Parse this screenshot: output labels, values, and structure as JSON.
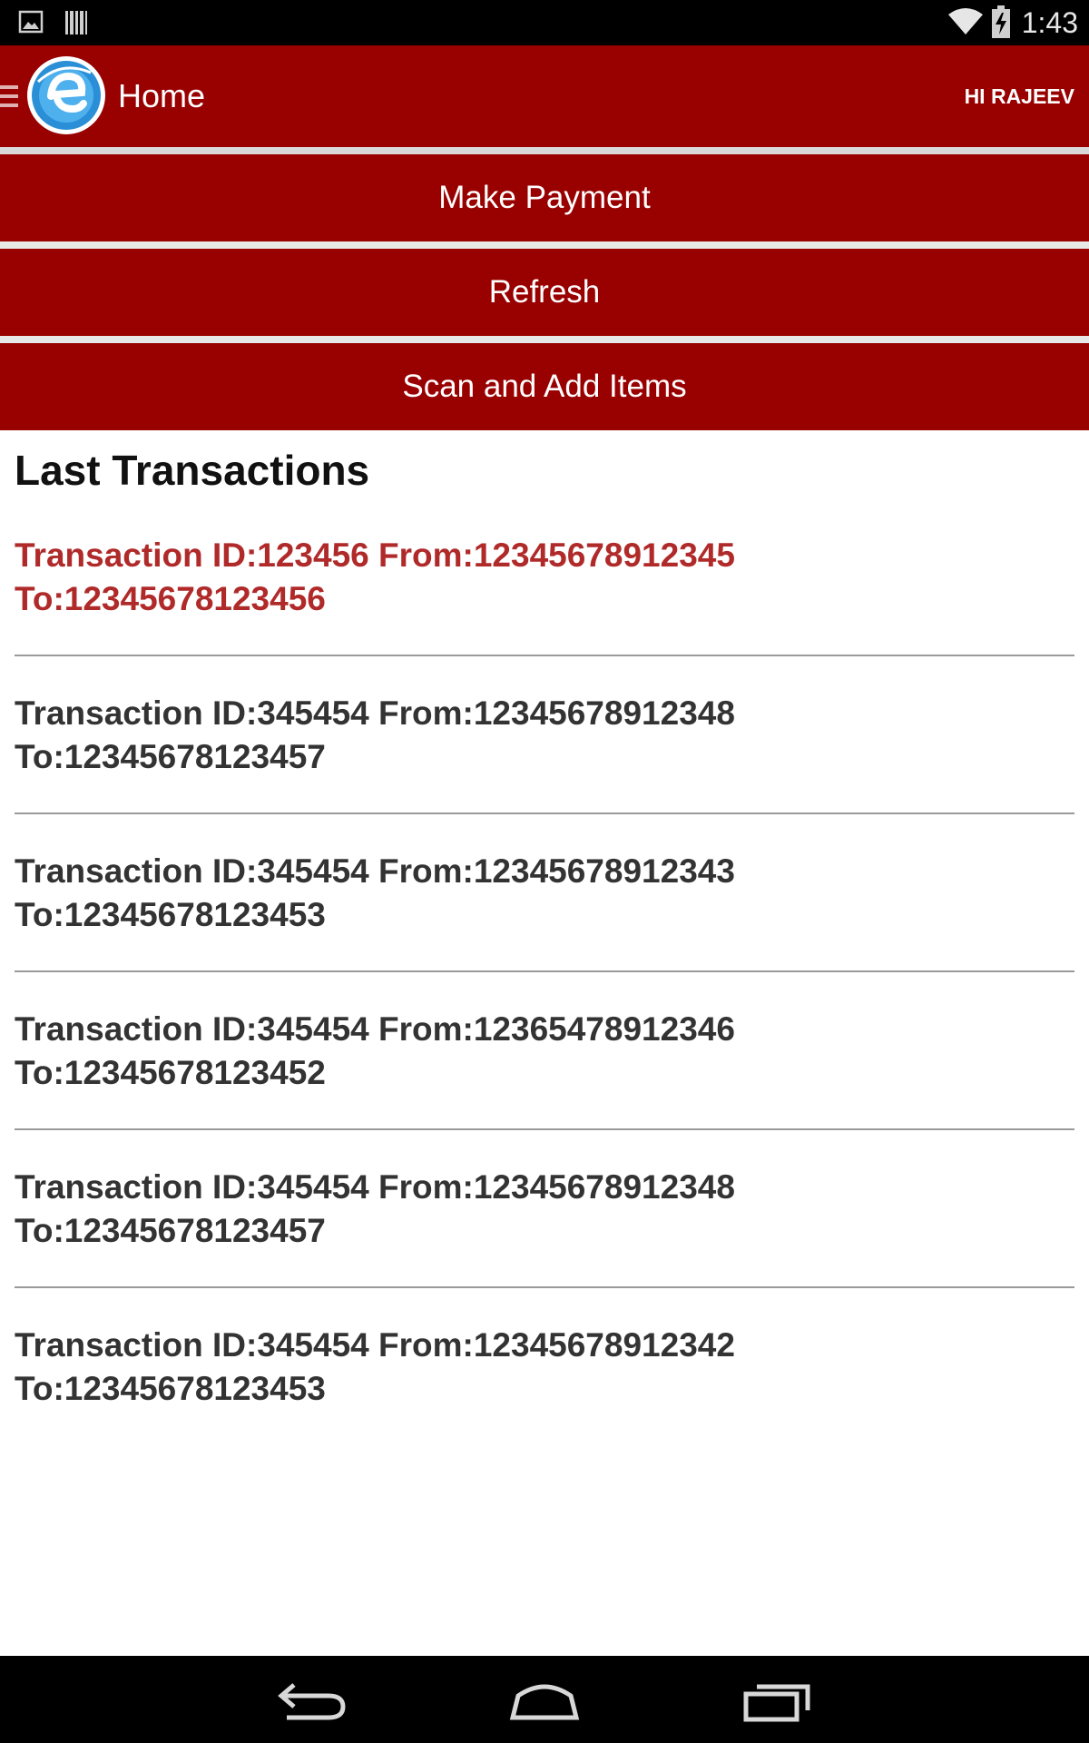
{
  "status_bar": {
    "time": "1:43",
    "icons": [
      "image-notification-icon",
      "barcode-notification-icon",
      "wifi-icon",
      "battery-charging-icon"
    ]
  },
  "action_bar": {
    "title": "Home",
    "greeting": "HI RAJEEV",
    "logo_icon": "e-logo-icon",
    "drawer_icon": "hamburger-icon"
  },
  "buttons": {
    "make_payment": "Make Payment",
    "refresh": "Refresh",
    "scan_add": "Scan and Add Items"
  },
  "transactions": {
    "title": "Last Transactions",
    "items": [
      {
        "line1": "Transaction ID:123456 From:12345678912345",
        "line2": "To:12345678123456",
        "selected": true
      },
      {
        "line1": "Transaction ID:345454 From:12345678912348",
        "line2": "To:12345678123457",
        "selected": false
      },
      {
        "line1": "Transaction ID:345454 From:12345678912343",
        "line2": "To:12345678123453",
        "selected": false
      },
      {
        "line1": "Transaction ID:345454 From:12365478912346",
        "line2": "To:12345678123452",
        "selected": false
      },
      {
        "line1": "Transaction ID:345454 From:12345678912348",
        "line2": "To:12345678123457",
        "selected": false
      },
      {
        "line1": "Transaction ID:345454 From:12345678912342",
        "line2": "To:12345678123453",
        "selected": false
      }
    ]
  },
  "nav_bar": {
    "icons": [
      "back-icon",
      "home-icon",
      "recents-icon"
    ]
  },
  "colors": {
    "brand_red": "#990000",
    "selected_text": "#b02a2a",
    "list_text": "#333333"
  }
}
